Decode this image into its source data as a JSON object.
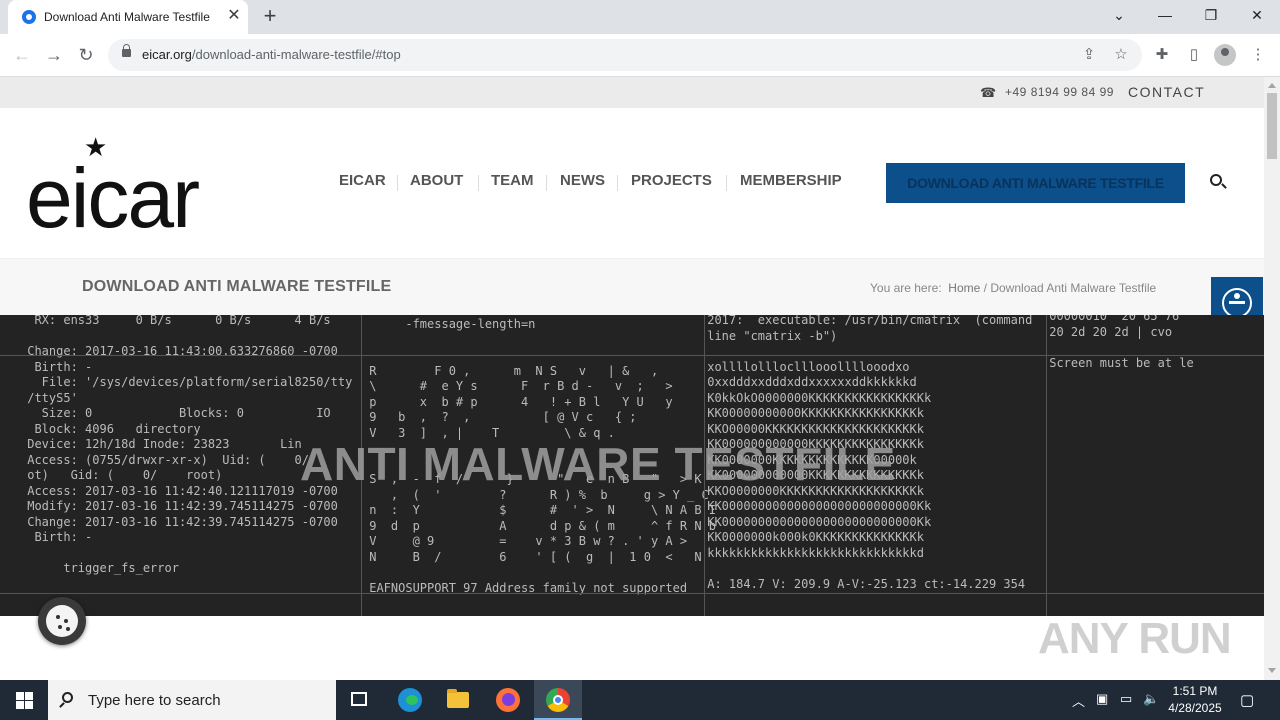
{
  "browser": {
    "tab_title": "Download Anti Malware Testfile",
    "tab_close": "✕",
    "new_tab": "+",
    "url_host": "eicar.org",
    "url_path": "/download-anti-malware-testfile/#top",
    "window_controls": {
      "minimize": "—",
      "restore": "❐",
      "close": "✕",
      "tab_search": "⌄"
    }
  },
  "site": {
    "phone": "+49 8194 99 84 99",
    "contact": "CONTACT",
    "logo_text": "eicar",
    "nav": [
      "EICAR",
      "ABOUT",
      "TEAM",
      "NEWS",
      "PROJECTS",
      "MEMBERSHIP"
    ],
    "download_button": "DOWNLOAD ANTI MALWARE TESTFILE",
    "page_title": "DOWNLOAD ANTI MALWARE TESTFILE",
    "breadcrumb": {
      "prefix": "You are here:",
      "home": "Home",
      "sep": "/",
      "current": "Download Anti Malware Testfile"
    },
    "hero_title": "ANTI MALWARE TESTFILE",
    "terminal": {
      "col1": "  RX: ens33     0 B/s      0 B/s      4 B/s\n\n Change: 2017-03-16 11:43:00.633276860 -0700\n  Birth: -\n   File: '/sys/devices/platform/serial8250/tty\n /ttyS5'\n   Size: 0            Blocks: 0          IO\n  Block: 4096   directory\n Device: 12h/18d Inode: 23823       Lin\n Access: (0755/drwxr-xr-x)  Uid: (    0/\n ot)   Gid: (    0/    root)\n Access: 2017-03-16 11:42:40.121117019 -0700\n Modify: 2017-03-16 11:42:39.745114275 -0700\n Change: 2017-03-16 11:42:39.745114275 -0700\n  Birth: -\n\n      trigger_fs_error",
      "col2": "      -fmessage-length=n\n\n\n R        F 0 ,      m  N S   v   | &   ,\n \\      #  e Y s      F  r B d -   v  ;   >\n p      x  b # p      4   ! + B l   Y U   y\n 9   b  ,  ?  ,          [ @ V c   { ;\n V   3  ]  , |    T         \\ & q .\n\n\n S  ,  -  f  /      }      \"   e  n B   \"   > K\n    ,  (  '        ?      R ) %  b     g > Y _ C\n n  :  Y           $      #  ' >  N     \\ N A B I\n 9  d  p           A      d p & ( m     ^ f R N b\n V     @ 9         =    v * 3 B w ? . ' y A >\n N     B  /        6    ' [ (  g  |  1 0  <   N\n\n EAFNOSUPPORT 97 Address family not supported",
      "col3": " 2017:  executable: /usr/bin/cmatrix  (command\n line \"cmatrix -b\")\n\n xollllollloclllooollllooodxo\n 0xxdddxxdddxddxxxxxxddkkkkkkd\n K0kkOkO0000000KKKKKKKKKKKKKKKKk\n KK00000000000KKKKKKKKKKKKKKKKk\n KKO00000KKKKKKKKKKKKKKKKKKKKKk\n KK000000000000KKKKKKKKKKKKKKKk\n KK0000000KKKKKKKKKKKKKK00000k\n KK000000000000KKKKKKKKKKKKKKKk\n KKO0000000KKKKKKKKKKKKKKKKKKKk\n KK000000000000000000000000000Kk\n KK000000000000000000000000000Kk\n KK0000000k000k0KKKKKKKKKKKKKKk\n kkkkkkkkkkkkkkkkkkkkkkkkkkkkkd\n\n A: 184.7 V: 209.9 A-V:-25.123 ct:-14.229 354",
      "col4": " 00000010  20 65 76\n 20 2d 20 2d | cvo\n\n Screen must be at le"
    },
    "watermark": "ANY RUN"
  },
  "taskbar": {
    "search_placeholder": "Type here to search",
    "time": "1:51 PM",
    "date": "4/28/2025"
  }
}
